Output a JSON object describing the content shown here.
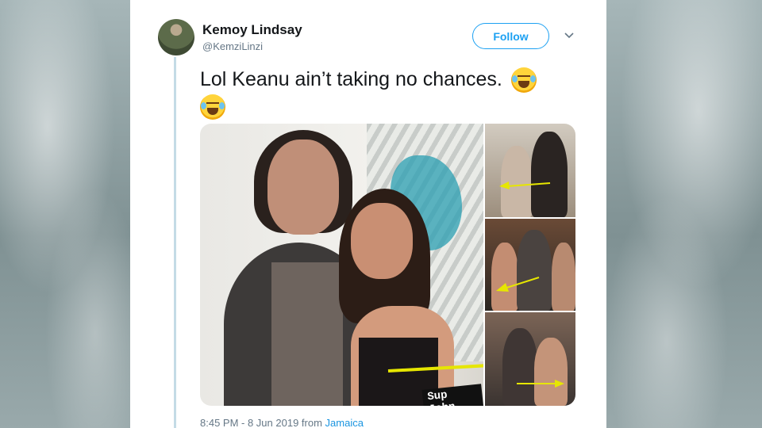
{
  "tweet": {
    "author_name": "Kemoy Lindsay",
    "author_handle": "@KemziLinzi",
    "follow_label": "Follow",
    "text": "Lol Keanu ain’t taking no chances.",
    "emoji": "face-with-tears-of-joy",
    "image_caption": "Sup John Wick",
    "timestamp": "8:45 PM - 8 Jun 2019 from",
    "location": "Jamaica"
  },
  "colors": {
    "accent": "#1da1f2",
    "text": "#14171a",
    "muted": "#657786",
    "thread_line": "#c4dbe6"
  }
}
